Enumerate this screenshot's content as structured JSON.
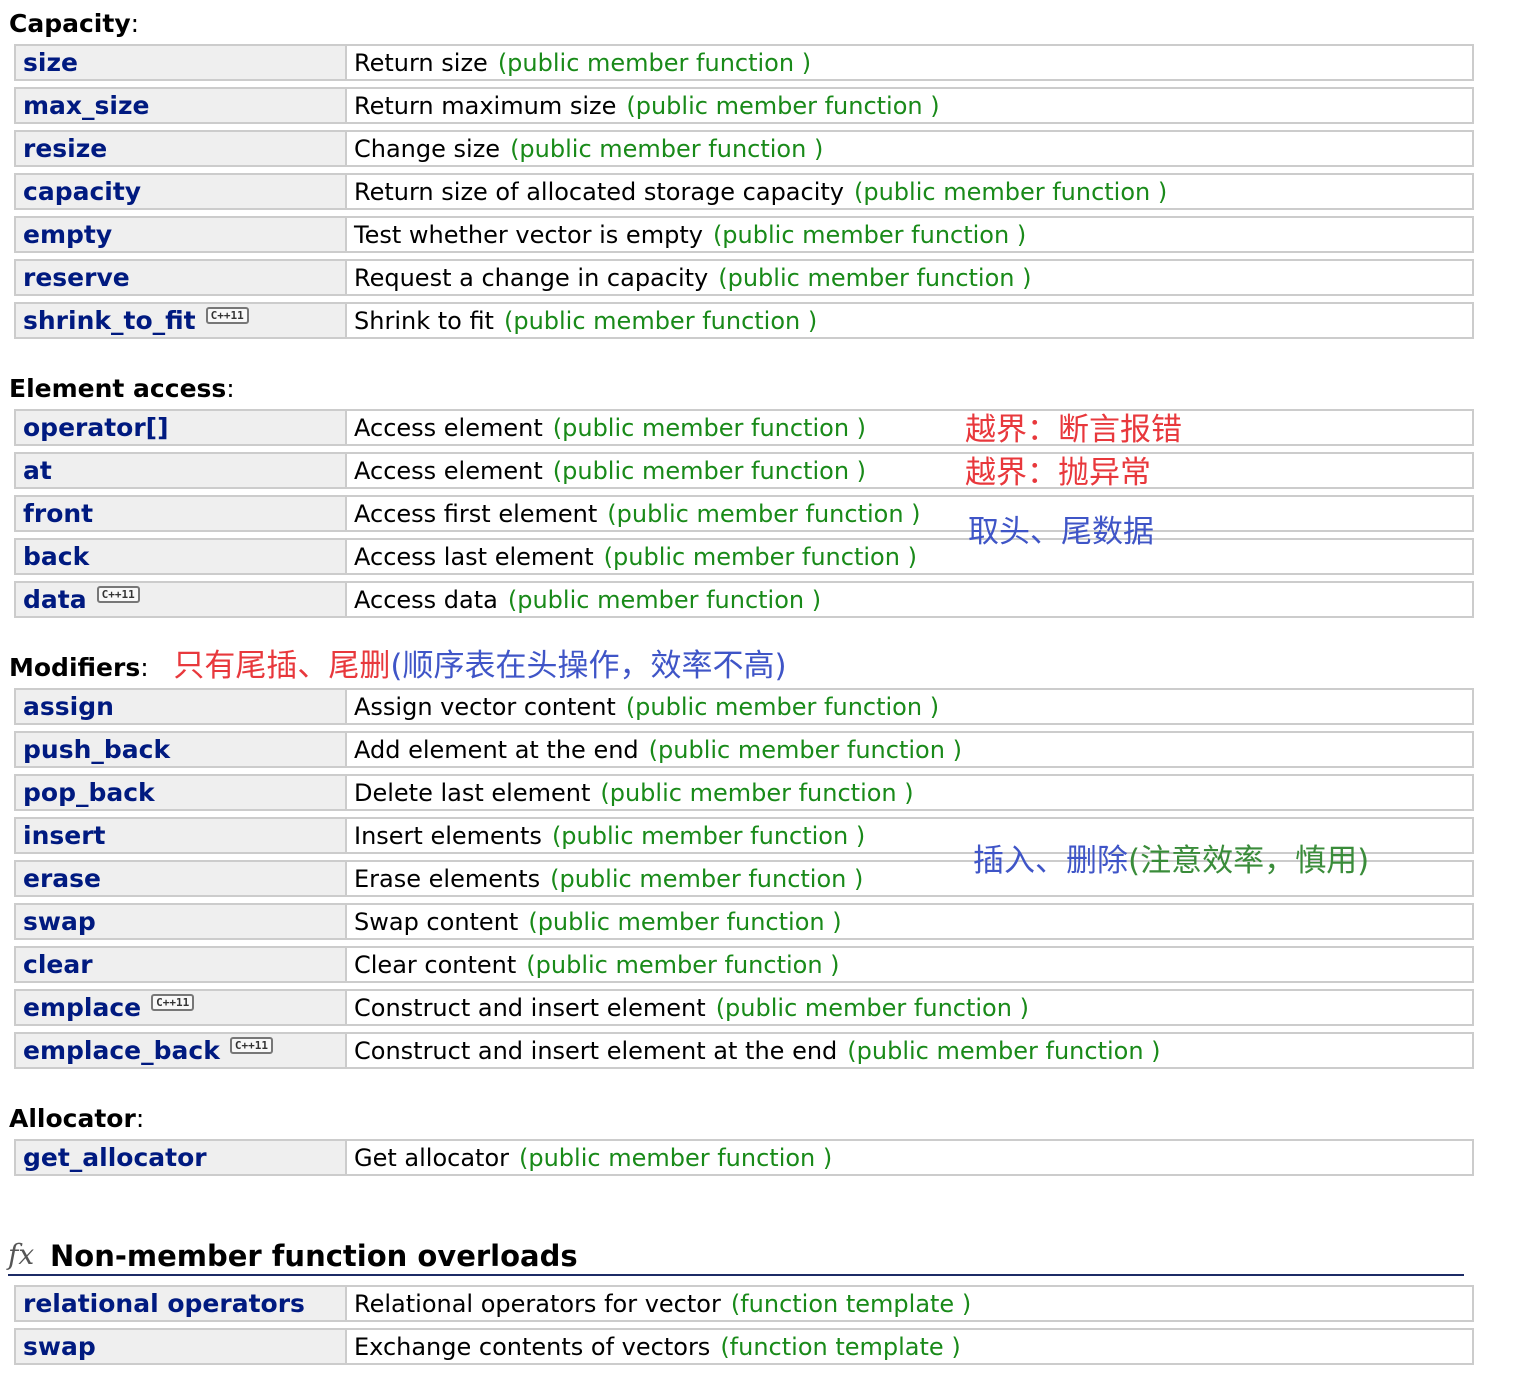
{
  "sections": {
    "capacity": {
      "title": "Capacity",
      "rows": [
        {
          "name": "size",
          "desc": "Return size",
          "kind": "(public member function )",
          "cpp11": ""
        },
        {
          "name": "max_size",
          "desc": "Return maximum size",
          "kind": "(public member function )",
          "cpp11": ""
        },
        {
          "name": "resize",
          "desc": "Change size",
          "kind": "(public member function )",
          "cpp11": ""
        },
        {
          "name": "capacity",
          "desc": "Return size of allocated storage capacity",
          "kind": "(public member function )",
          "cpp11": ""
        },
        {
          "name": "empty",
          "desc": "Test whether vector is empty",
          "kind": "(public member function )",
          "cpp11": ""
        },
        {
          "name": "reserve",
          "desc": "Request a change in capacity",
          "kind": "(public member function )",
          "cpp11": ""
        },
        {
          "name": "shrink_to_fit",
          "desc": "Shrink to fit",
          "kind": "(public member function )",
          "cpp11": "C++11"
        }
      ]
    },
    "element_access": {
      "title": "Element access",
      "rows": [
        {
          "name": "operator[]",
          "desc": "Access element",
          "kind": "(public member function )",
          "cpp11": ""
        },
        {
          "name": "at",
          "desc": "Access element",
          "kind": "(public member function )",
          "cpp11": ""
        },
        {
          "name": "front",
          "desc": "Access first element",
          "kind": "(public member function )",
          "cpp11": ""
        },
        {
          "name": "back",
          "desc": "Access last element",
          "kind": "(public member function )",
          "cpp11": ""
        },
        {
          "name": "data",
          "desc": "Access data",
          "kind": "(public member function )",
          "cpp11": "C++11"
        }
      ]
    },
    "modifiers": {
      "title": "Modifiers",
      "note_red": "只有尾插、尾删",
      "note_blue": "(顺序表在头操作，效率不高)",
      "rows": [
        {
          "name": "assign",
          "desc": "Assign vector content",
          "kind": "(public member function )",
          "cpp11": ""
        },
        {
          "name": "push_back",
          "desc": "Add element at the end",
          "kind": "(public member function )",
          "cpp11": ""
        },
        {
          "name": "pop_back",
          "desc": "Delete last element",
          "kind": "(public member function )",
          "cpp11": ""
        },
        {
          "name": "insert",
          "desc": "Insert elements",
          "kind": "(public member function )",
          "cpp11": ""
        },
        {
          "name": "erase",
          "desc": "Erase elements",
          "kind": "(public member function )",
          "cpp11": ""
        },
        {
          "name": "swap",
          "desc": "Swap content",
          "kind": "(public member function )",
          "cpp11": ""
        },
        {
          "name": "clear",
          "desc": "Clear content",
          "kind": "(public member function )",
          "cpp11": ""
        },
        {
          "name": "emplace",
          "desc": "Construct and insert element",
          "kind": "(public member function )",
          "cpp11": "C++11"
        },
        {
          "name": "emplace_back",
          "desc": "Construct and insert element at the end",
          "kind": "(public member function )",
          "cpp11": "C++11"
        }
      ]
    },
    "allocator": {
      "title": "Allocator",
      "rows": [
        {
          "name": "get_allocator",
          "desc": "Get allocator",
          "kind": "(public member function )",
          "cpp11": ""
        }
      ]
    },
    "non_member": {
      "icon_glyph": "fx",
      "title": "Non-member function overloads",
      "rows": [
        {
          "name": "relational operators",
          "desc": "Relational operators for vector",
          "kind": "(function template )",
          "cpp11": ""
        },
        {
          "name": "swap",
          "desc": "Exchange contents of vectors",
          "kind": "(function template )",
          "cpp11": ""
        }
      ]
    }
  },
  "annotations": {
    "operator_bracket": "越界：断言报错",
    "at": "越界：抛异常",
    "front_back": "取头、尾数据",
    "insert_erase_blue": "插入、删除",
    "insert_erase_green": "(注意效率，慎用)"
  },
  "colors": {
    "name_text": "#001a80",
    "kind_text": "#198a19",
    "note_red": "#e8383c",
    "note_blue": "#3f55c7",
    "note_green": "#3a8c3a"
  }
}
